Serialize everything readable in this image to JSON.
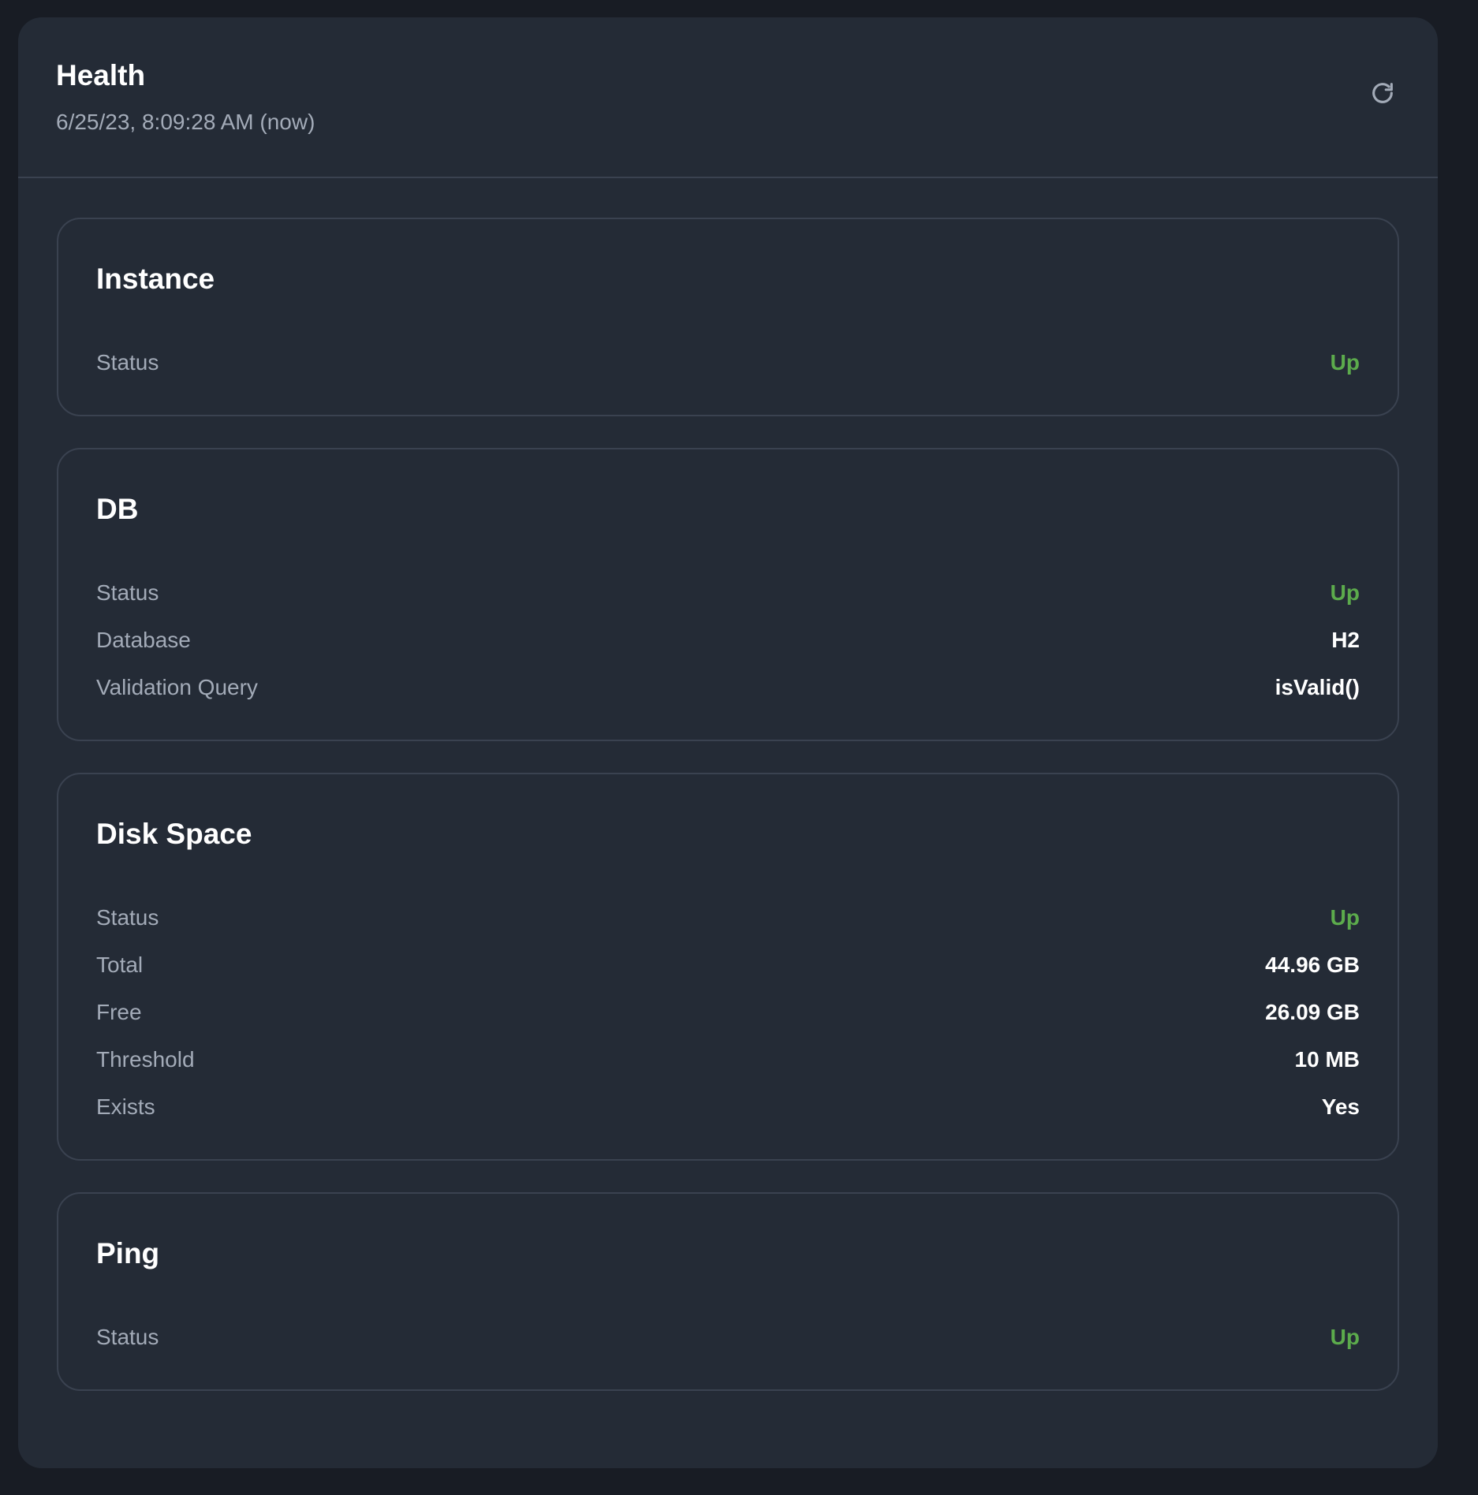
{
  "header": {
    "title": "Health",
    "timestamp": "6/25/23, 8:09:28 AM (now)",
    "refresh_icon": "refresh-icon"
  },
  "colors": {
    "status_up": "#5cab4c",
    "background": "#181c24",
    "panel": "#242b36"
  },
  "cards": [
    {
      "title": "Instance",
      "rows": [
        {
          "label": "Status",
          "value": "Up",
          "status": true
        }
      ]
    },
    {
      "title": "DB",
      "rows": [
        {
          "label": "Status",
          "value": "Up",
          "status": true
        },
        {
          "label": "Database",
          "value": "H2"
        },
        {
          "label": "Validation Query",
          "value": "isValid()"
        }
      ]
    },
    {
      "title": "Disk Space",
      "rows": [
        {
          "label": "Status",
          "value": "Up",
          "status": true
        },
        {
          "label": "Total",
          "value": "44.96 GB"
        },
        {
          "label": "Free",
          "value": "26.09 GB"
        },
        {
          "label": "Threshold",
          "value": "10 MB"
        },
        {
          "label": "Exists",
          "value": "Yes"
        }
      ]
    },
    {
      "title": "Ping",
      "rows": [
        {
          "label": "Status",
          "value": "Up",
          "status": true
        }
      ]
    }
  ]
}
